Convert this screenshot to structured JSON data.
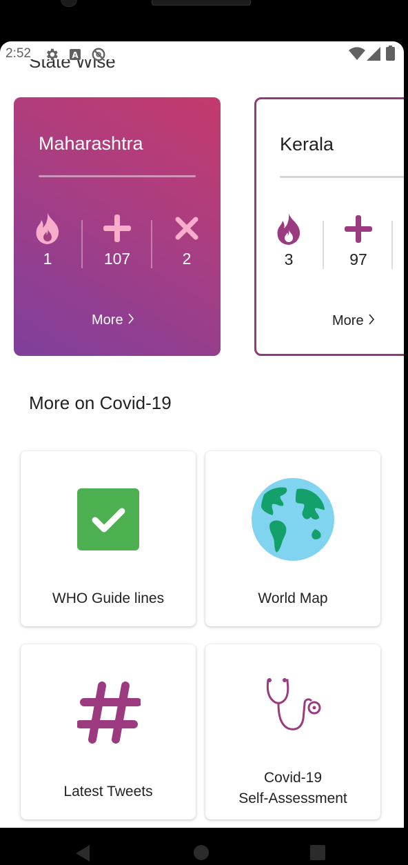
{
  "status_bar": {
    "time": "2:52",
    "left_icons": [
      "gear-icon",
      "text-a-icon",
      "do-not-disturb-icon"
    ],
    "right_icons": [
      "wifi-icon",
      "cell-signal-icon",
      "battery-icon"
    ]
  },
  "header_peek": "State Wise",
  "states": [
    {
      "name": "Maharashtra",
      "stats": [
        "1",
        "107",
        "2"
      ],
      "more_label": "More",
      "gradient": [
        "#7e3f9c",
        "#c43a6c"
      ]
    },
    {
      "name": "Kerala",
      "stats": [
        "3",
        "97"
      ],
      "more_label": "More",
      "border_color": "#8e3b7b"
    }
  ],
  "stat_icons": [
    "fire-icon",
    "plus-icon",
    "cross-icon"
  ],
  "section_title": "More on Covid-19",
  "tiles": [
    {
      "label": "WHO Guide lines",
      "icon": "checkbox-icon",
      "icon_color": "#4caf50"
    },
    {
      "label": "World Map",
      "icon": "globe-icon",
      "icon_color": "#81d4ef"
    },
    {
      "label": "Latest Tweets",
      "icon": "hashtag-icon",
      "icon_color": "#9c3a7f"
    },
    {
      "label_line1": "Covid-19",
      "label_line2": "Self-Assessment",
      "icon": "stethoscope-icon",
      "icon_color": "#9c3a7f"
    }
  ],
  "nav": [
    "back-button",
    "home-button",
    "recents-button"
  ]
}
